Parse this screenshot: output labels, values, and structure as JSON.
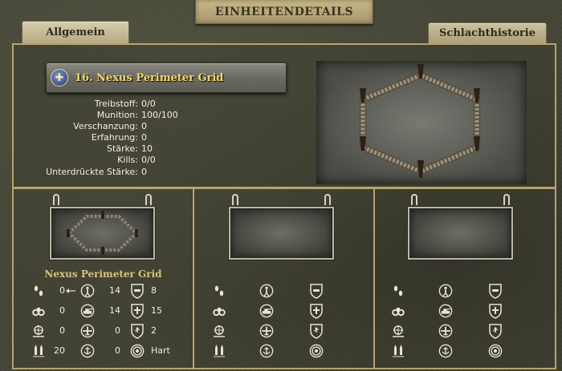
{
  "window": {
    "title": "EINHEITENDETAILS"
  },
  "tabs": [
    {
      "label": "Allgemein",
      "active": true
    },
    {
      "label": "Schlachthistorie",
      "active": false
    }
  ],
  "unit": {
    "name": "16. Nexus Perimeter Grid",
    "faction_icon": "faction-cross-icon"
  },
  "stats": [
    {
      "label": "Treibstoff:",
      "value": "0/0"
    },
    {
      "label": "Munition:",
      "value": "100/100"
    },
    {
      "label": "Verschanzung:",
      "value": "0"
    },
    {
      "label": "Erfahrung:",
      "value": "0"
    },
    {
      "label": "Stärke:",
      "value": "10"
    },
    {
      "label": "Kills:",
      "value": "0/0"
    },
    {
      "label": "Unterdrückte Stärke:",
      "value": "0"
    }
  ],
  "slots": [
    {
      "name": "Nexus Perimeter Grid",
      "rows": [
        {
          "a_icon": "movement-icon",
          "a_val": "0",
          "b_icon": "soft-attack-icon",
          "b_val": "14",
          "c_icon": "ground-defense-icon",
          "c_val": "8"
        },
        {
          "a_icon": "spotting-icon",
          "a_val": "0",
          "b_icon": "hard-attack-icon",
          "b_val": "14",
          "c_icon": "air-defense-icon",
          "c_val": "15"
        },
        {
          "a_icon": "range-icon",
          "a_val": "0",
          "b_icon": "air-attack-icon",
          "b_val": "0",
          "c_icon": "close-defense-icon",
          "c_val": "2"
        },
        {
          "a_icon": "ammo-icon",
          "a_val": "20",
          "b_icon": "naval-attack-icon",
          "b_val": "0",
          "c_icon": "target-type-icon",
          "c_val": "Hart"
        }
      ]
    },
    {
      "name": "",
      "rows": []
    },
    {
      "name": "",
      "rows": []
    }
  ]
}
